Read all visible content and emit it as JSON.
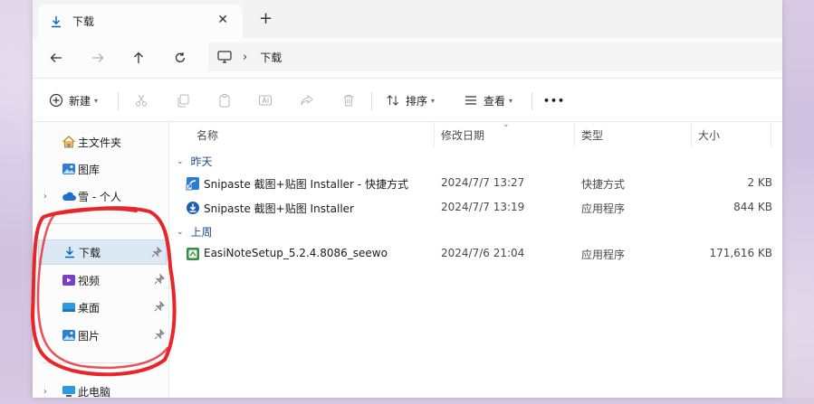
{
  "tab": {
    "title": "下载",
    "close_glyph": "✕",
    "new_tab_glyph": "+"
  },
  "address": {
    "separator": "›",
    "crumb": "下载"
  },
  "commands": {
    "new_label": "新建",
    "sort_label": "排序",
    "view_label": "查看",
    "more_glyph": "•••"
  },
  "sidebar": {
    "items": [
      {
        "label": "主文件夹",
        "icon": "home-icon"
      },
      {
        "label": "图库",
        "icon": "gallery-icon"
      },
      {
        "label": "雪 - 个人",
        "icon": "onedrive-cloud-icon"
      },
      {
        "label": "下载",
        "icon": "download-icon",
        "pinned": true,
        "selected": true
      },
      {
        "label": "视频",
        "icon": "video-icon",
        "pinned": true
      },
      {
        "label": "桌面",
        "icon": "desktop-icon",
        "pinned": true
      },
      {
        "label": "图片",
        "icon": "pictures-icon",
        "pinned": true
      },
      {
        "label": "此电脑",
        "icon": "this-pc-icon"
      }
    ]
  },
  "columns": {
    "name": "名称",
    "date": "修改日期",
    "type": "类型",
    "size": "大小"
  },
  "groups": [
    {
      "label": "昨天",
      "files": [
        {
          "name": "Snipaste 截图+贴图 Installer - 快捷方式",
          "date": "2024/7/7 13:27",
          "type": "快捷方式",
          "size": "2 KB",
          "icon": "shortcut-icon"
        },
        {
          "name": "Snipaste 截图+贴图 Installer",
          "date": "2024/7/7 13:19",
          "type": "应用程序",
          "size": "844 KB",
          "icon": "installer-icon"
        }
      ]
    },
    {
      "label": "上周",
      "files": [
        {
          "name": "EasiNoteSetup_5.2.4.8086_seewo",
          "date": "2024/7/6 21:04",
          "type": "应用程序",
          "size": "171,616 KB",
          "icon": "setup-app-icon"
        }
      ]
    }
  ],
  "colors": {
    "accent": "#0067c0",
    "selection": "#dde8f5",
    "annotation": "#e8262a"
  }
}
